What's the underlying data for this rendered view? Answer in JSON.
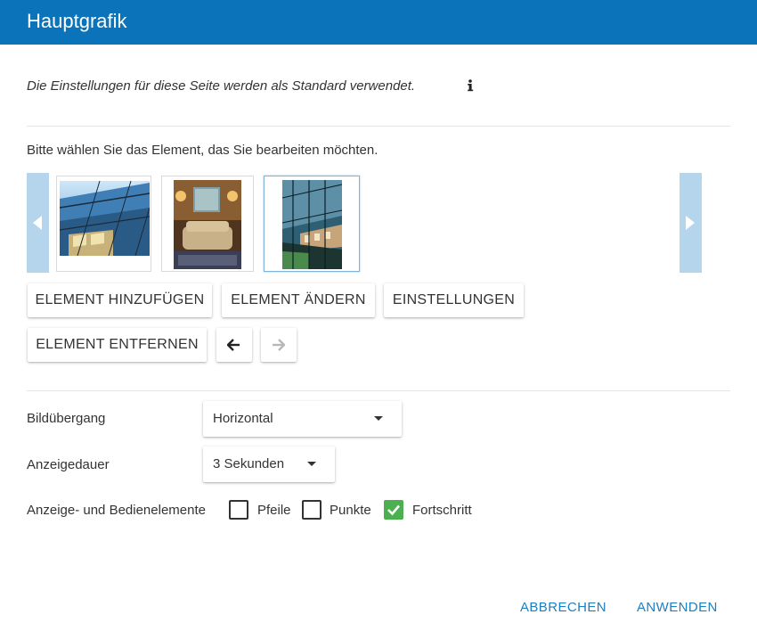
{
  "dialog": {
    "title": "Hauptgrafik"
  },
  "info": {
    "text": "Die Einstellungen für diese Seite werden als Standard verwendet.",
    "icon": "info-icon"
  },
  "carousel": {
    "prompt": "Bitte wählen Sie das Element, das Sie bearbeiten möchten.",
    "prev_icon": "chevron-left-icon",
    "next_icon": "chevron-right-icon",
    "selected_index": 2
  },
  "element_actions": {
    "add_label": "ELEMENT HINZUFÜGEN",
    "edit_label": "ELEMENT ÄNDERN",
    "settings_label": "EINSTELLUNGEN",
    "remove_label": "ELEMENT ENTFERNEN",
    "move_left_icon": "arrow-left-icon",
    "move_right_icon": "arrow-right-icon"
  },
  "form": {
    "transition": {
      "label": "Bildübergang",
      "value": "Horizontal"
    },
    "duration": {
      "label": "Anzeigedauer",
      "value": "3 Sekunden"
    },
    "controls": {
      "label": "Anzeige- und Bedienelemente",
      "options": [
        {
          "label": "Pfeile",
          "checked": false
        },
        {
          "label": "Punkte",
          "checked": false
        },
        {
          "label": "Fortschritt",
          "checked": true
        }
      ]
    }
  },
  "footer": {
    "cancel_label": "ABBRECHEN",
    "apply_label": "ANWENDEN"
  },
  "colors": {
    "header": "#0b73b9",
    "carousel_button": "#b5d5ec",
    "checkbox_checked": "#4caf50",
    "link": "#1d7fbe"
  }
}
